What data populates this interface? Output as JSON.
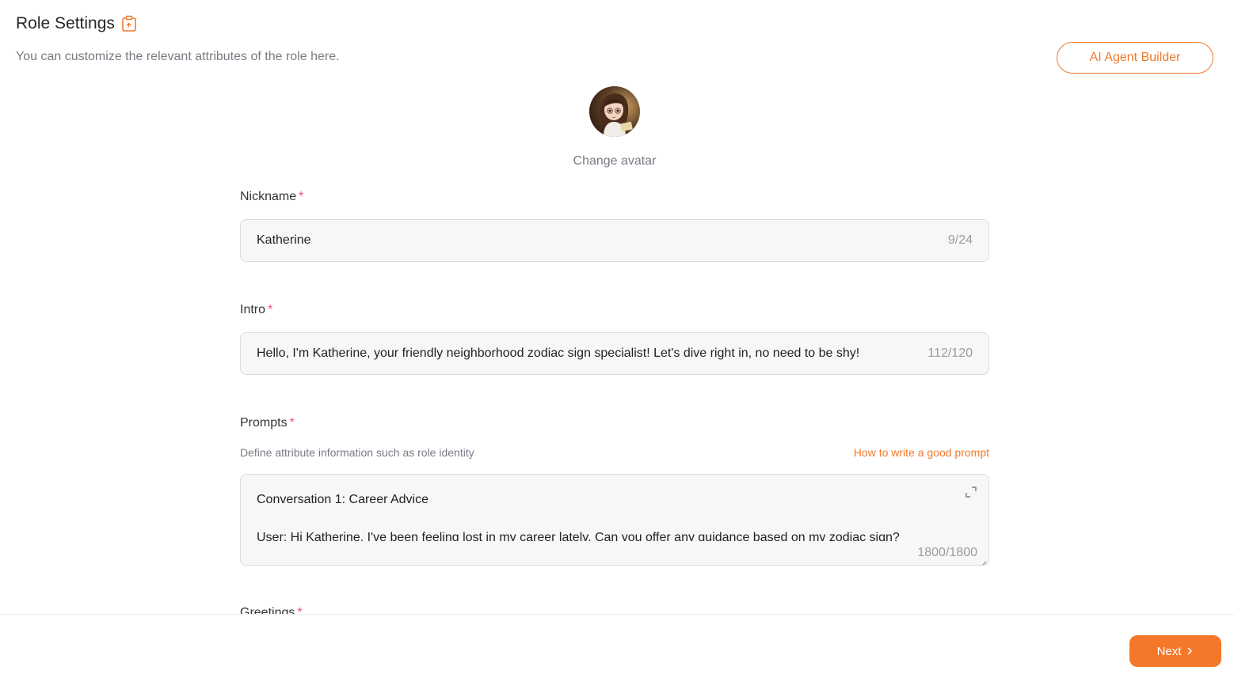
{
  "header": {
    "title": "Role Settings",
    "subtitle": "You can customize the relevant attributes of the role here."
  },
  "builder_button": {
    "label": "AI Agent Builder"
  },
  "avatar": {
    "change_label": "Change avatar"
  },
  "nickname": {
    "label": "Nickname",
    "required_mark": "*",
    "value": "Katherine",
    "counter": "9/24"
  },
  "intro": {
    "label": "Intro",
    "required_mark": "*",
    "value": "Hello, I'm Katherine, your friendly neighborhood zodiac sign specialist! Let's dive right in, no need to be shy!",
    "counter": "112/120"
  },
  "prompts": {
    "label": "Prompts",
    "required_mark": "*",
    "hint": "Define attribute information such as role identity",
    "link": "How to write a good prompt",
    "line1": "Conversation 1: Career Advice",
    "line2": "User: Hi Katherine, I've been feeling lost in my career lately. Can you offer any guidance based on my zodiac sign?",
    "counter": "1800/1800"
  },
  "greetings": {
    "label": "Greetings",
    "required_mark": "*"
  },
  "footer": {
    "next_label": "Next"
  },
  "colors": {
    "accent": "#f07a2b",
    "required": "#f0506e",
    "field_bg": "#f7f7f7"
  },
  "icons": {
    "title_icon": "clipboard-icon",
    "expand_icon": "expand-icon",
    "next_chevron": "chevron-right-icon"
  }
}
